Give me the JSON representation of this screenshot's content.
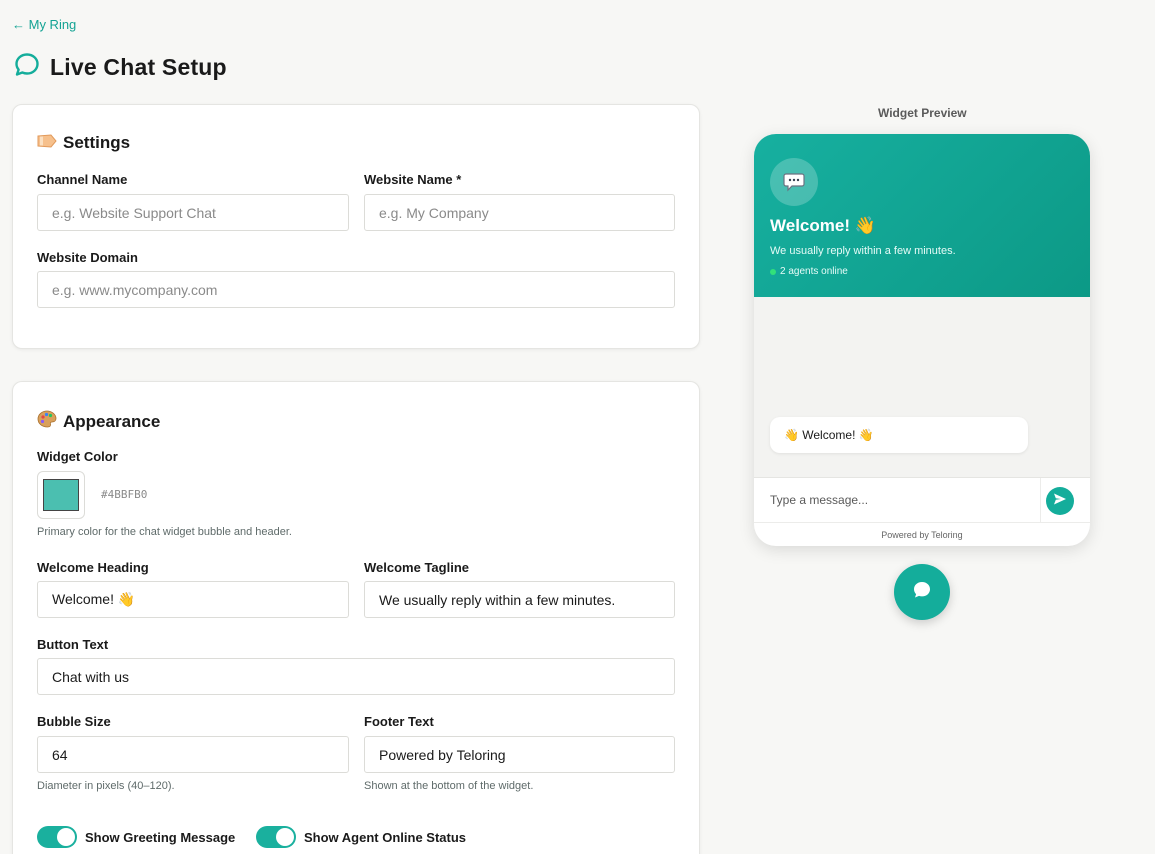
{
  "nav": {
    "back_label": "← My Ring"
  },
  "page": {
    "title": "Live Chat Setup"
  },
  "settings": {
    "title": "Settings",
    "channel_name": {
      "label": "Channel Name",
      "placeholder": "e.g. Website Support Chat",
      "value": ""
    },
    "website_name": {
      "label": "Website Name *",
      "placeholder": "e.g. My Company",
      "value": ""
    },
    "website_domain": {
      "label": "Website Domain",
      "placeholder": "e.g. www.mycompany.com",
      "value": ""
    }
  },
  "appearance": {
    "title": "Appearance",
    "widget_color": {
      "label": "Widget Color",
      "hex": "#4BBFB0",
      "hint": "Primary color for the chat widget bubble and header."
    },
    "welcome_heading": {
      "label": "Welcome Heading",
      "value": "Welcome! 👋"
    },
    "welcome_tagline": {
      "label": "Welcome Tagline",
      "value": "We usually reply within a few minutes."
    },
    "button_text": {
      "label": "Button Text",
      "value": "Chat with us"
    },
    "bubble_size": {
      "label": "Bubble Size",
      "value": "64",
      "hint": "Diameter in pixels (40–120)."
    },
    "footer_text": {
      "label": "Footer Text",
      "value": "Powered by Teloring",
      "hint": "Shown at the bottom of the widget."
    },
    "toggles": [
      {
        "label": "Show Greeting Message",
        "on": true
      },
      {
        "label": "Show Agent Online Status",
        "on": true
      }
    ]
  },
  "preview": {
    "label": "Widget Preview",
    "heading": "Welcome! 👋",
    "tagline": "We usually reply within a few minutes.",
    "online_status": "2 agents online",
    "greeting": "👋 Welcome! 👋",
    "message_placeholder": "Type a message...",
    "footer": "Powered by Teloring"
  },
  "colors": {
    "accent": "#14ad9b",
    "widget": "#4bbfb0"
  },
  "icons": {
    "title": "chat-bubble-icon",
    "settings": "tag-icon",
    "appearance": "palette-icon",
    "avatar": "speech-balloon-icon",
    "send": "send-icon",
    "launcher": "chat-bubble-icon"
  }
}
